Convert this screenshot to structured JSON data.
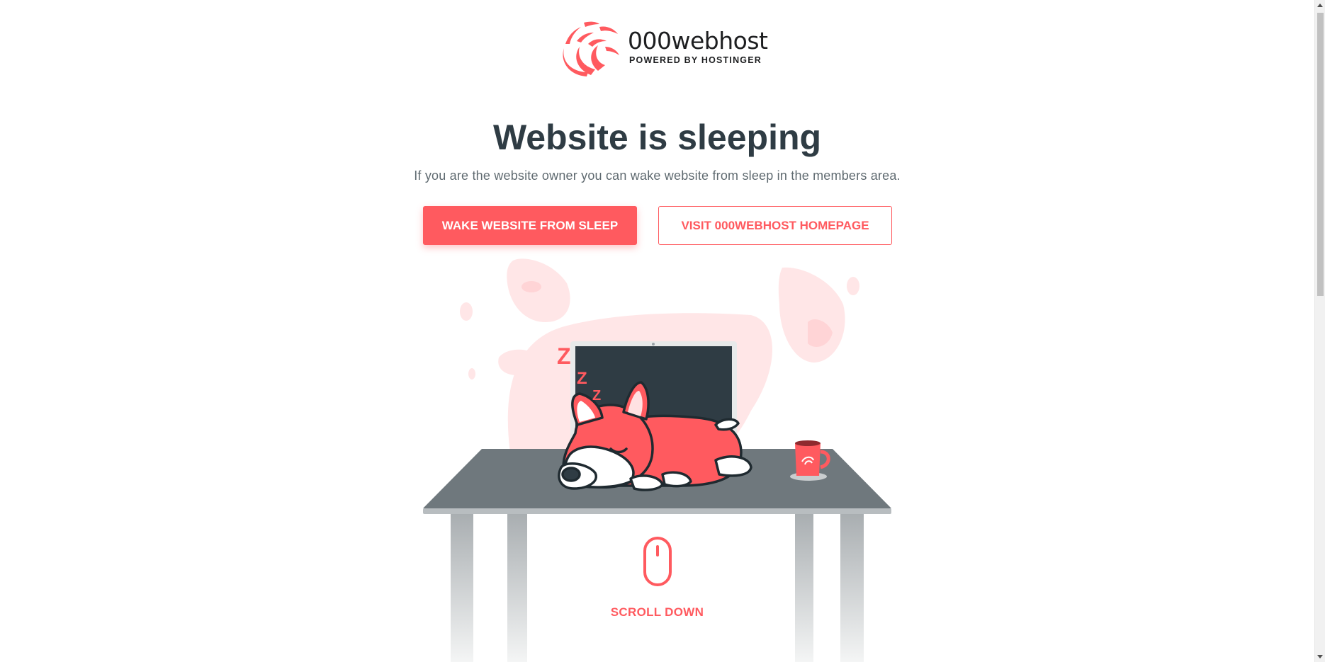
{
  "brand": {
    "name": "000webhost",
    "tagline": "POWERED BY HOSTINGER",
    "accent_color": "#ff5a5f",
    "dark_color": "#2f3c44"
  },
  "main": {
    "title": "Website is sleeping",
    "subtitle": "If you are the website owner you can wake website from sleep in the members area.",
    "primary_button": "WAKE WEBSITE FROM SLEEP",
    "secondary_button": "VISIT 000WEBHOST HOMEPAGE"
  },
  "illustration": {
    "zzz": [
      "Z",
      "Z",
      "Z"
    ],
    "icons": [
      "sleeping-corgi-icon",
      "laptop-icon",
      "desk-icon",
      "mug-icon",
      "mouse-icon"
    ]
  },
  "scroll": {
    "label": "SCROLL DOWN"
  }
}
